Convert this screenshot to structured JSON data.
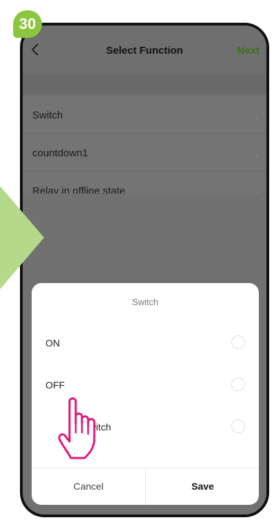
{
  "step": "30",
  "header": {
    "title": "Select Function",
    "next_label": "Next"
  },
  "list": [
    {
      "label": "Switch"
    },
    {
      "label": "countdown1"
    },
    {
      "label": "Relay in offline state"
    }
  ],
  "sheet": {
    "title": "Switch",
    "options": [
      {
        "label": "ON"
      },
      {
        "label": "OFF"
      },
      {
        "label": "Switch"
      }
    ],
    "cancel_label": "Cancel",
    "save_label": "Save"
  },
  "colors": {
    "accent_green": "#8cc63f",
    "next_green": "#3c6f1c",
    "hand_pink": "#e0157a"
  },
  "icons": {
    "back": "chevron-left-icon",
    "item_arrow": "chevron-right-icon",
    "pointer": "hand-pointer-icon"
  }
}
